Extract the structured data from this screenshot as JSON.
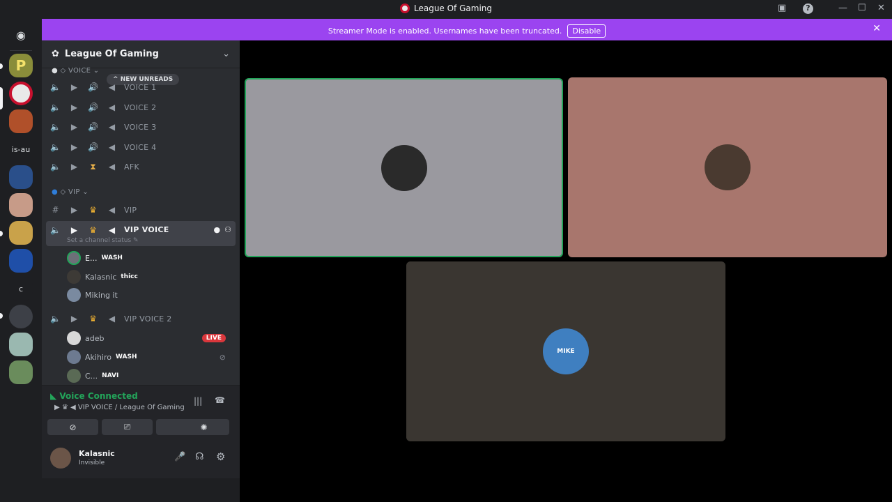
{
  "window": {
    "title": "League Of Gaming"
  },
  "banner": {
    "message": "Streamer Mode is enabled. Usernames have been truncated.",
    "disable_label": "Disable"
  },
  "rail": {
    "server_text": "is-au",
    "server_letter": "c"
  },
  "server": {
    "name": "League Of Gaming"
  },
  "unreads": "NEW UNREADS",
  "categories": {
    "voice": "◇ VOICE",
    "vip": "◇ VIP"
  },
  "channels": {
    "voice1": "VOICE 1",
    "voice2": "VOICE 2",
    "voice3": "VOICE 3",
    "voice4": "VOICE 4",
    "afk": "AFK",
    "vip": "VIP",
    "vip_voice": "VIP VOICE",
    "vip_voice_2": "VIP VOICE 2"
  },
  "channel_status": "Set a channel status",
  "users": [
    {
      "name": "E...",
      "tag": "WASH"
    },
    {
      "name": "Kalasnic",
      "tag": "thicc"
    },
    {
      "name": "Miking it",
      "tag": ""
    },
    {
      "name": "adeb",
      "tag": ""
    },
    {
      "name": "Akihiro",
      "tag": "WASH"
    },
    {
      "name": "C...",
      "tag": "NAVI"
    }
  ],
  "live_badge": "LIVE",
  "voice": {
    "status": "Voice Connected",
    "location": "VIP VOICE / League Of Gaming"
  },
  "me": {
    "name": "Kalasnic",
    "status": "Invisible"
  },
  "tiles": {
    "avatar_label": "MIKE"
  },
  "colors": {
    "accent": "#9b44f0",
    "speaking": "#23a55a",
    "live": "#da373c"
  }
}
